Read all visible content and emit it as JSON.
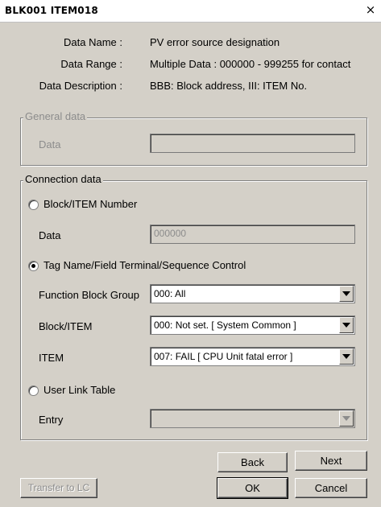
{
  "window": {
    "title": "BLK001 ITEM018",
    "close_glyph": "×"
  },
  "info": [
    {
      "label": "Data Name :",
      "value": "PV error source designation"
    },
    {
      "label": "Data Range :",
      "value": "Multiple Data : 000000 - 999255 for contact"
    },
    {
      "label": "Data Description :",
      "value": "BBB: Block address, III: ITEM No."
    }
  ],
  "general": {
    "legend": "General data",
    "data_label": "Data",
    "data_value": ""
  },
  "connection": {
    "legend": "Connection data",
    "block_item_number": {
      "label": "Block/ITEM Number",
      "selected": false,
      "data_label": "Data",
      "data_value": "000000"
    },
    "tag_name": {
      "label": "Tag Name/Field Terminal/Sequence Control",
      "selected": true,
      "fbg_label": "Function Block Group",
      "fbg_value": "000: All",
      "block_item_label": "Block/ITEM",
      "block_item_value": "000: Not set. [ System Common ]",
      "item_label": "ITEM",
      "item_value": "007: FAIL [ CPU Unit fatal error ]"
    },
    "user_link": {
      "label": "User Link Table",
      "selected": false,
      "entry_label": "Entry",
      "entry_value": ""
    }
  },
  "buttons": {
    "back": "Back",
    "next": "Next",
    "ok": "OK",
    "cancel": "Cancel",
    "transfer": "Transfer to LC"
  }
}
